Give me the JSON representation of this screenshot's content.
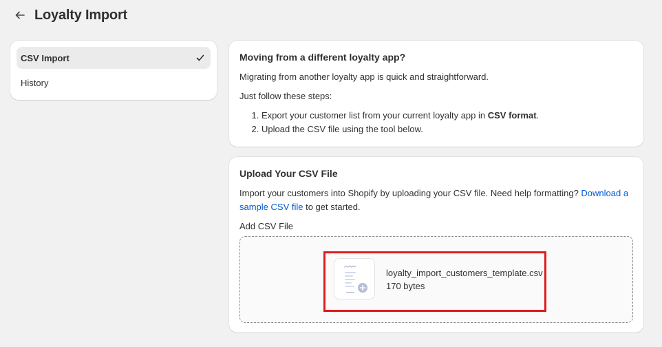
{
  "header": {
    "title": "Loyalty Import",
    "back_icon": "arrow-left-icon"
  },
  "sidebar": {
    "items": [
      {
        "label": "CSV Import",
        "active": true,
        "icon": "checkmark-icon"
      },
      {
        "label": "History",
        "active": false
      }
    ]
  },
  "info_card": {
    "title": "Moving from a different loyalty app?",
    "intro": "Migrating from another loyalty app is quick and straightforward.",
    "lead": "Just follow these steps:",
    "step1_prefix": "Export your customer list from your current loyalty app in ",
    "step1_bold": "CSV format",
    "step1_suffix": ".",
    "step2": "Upload the CSV file using the tool below."
  },
  "upload_card": {
    "title": "Upload Your CSV File",
    "description_prefix": "Import your customers into Shopify by uploading your CSV file. Need help formatting? ",
    "link_text": "Download a sample CSV file",
    "description_suffix": " to get started.",
    "field_label": "Add CSV File",
    "file": {
      "name": "loyalty_import_customers_template.csv",
      "size": "170 bytes",
      "icon": "file-document-icon"
    }
  },
  "colors": {
    "link": "#005bd3",
    "highlight": "#e01b1b",
    "background": "#f1f1f1"
  }
}
